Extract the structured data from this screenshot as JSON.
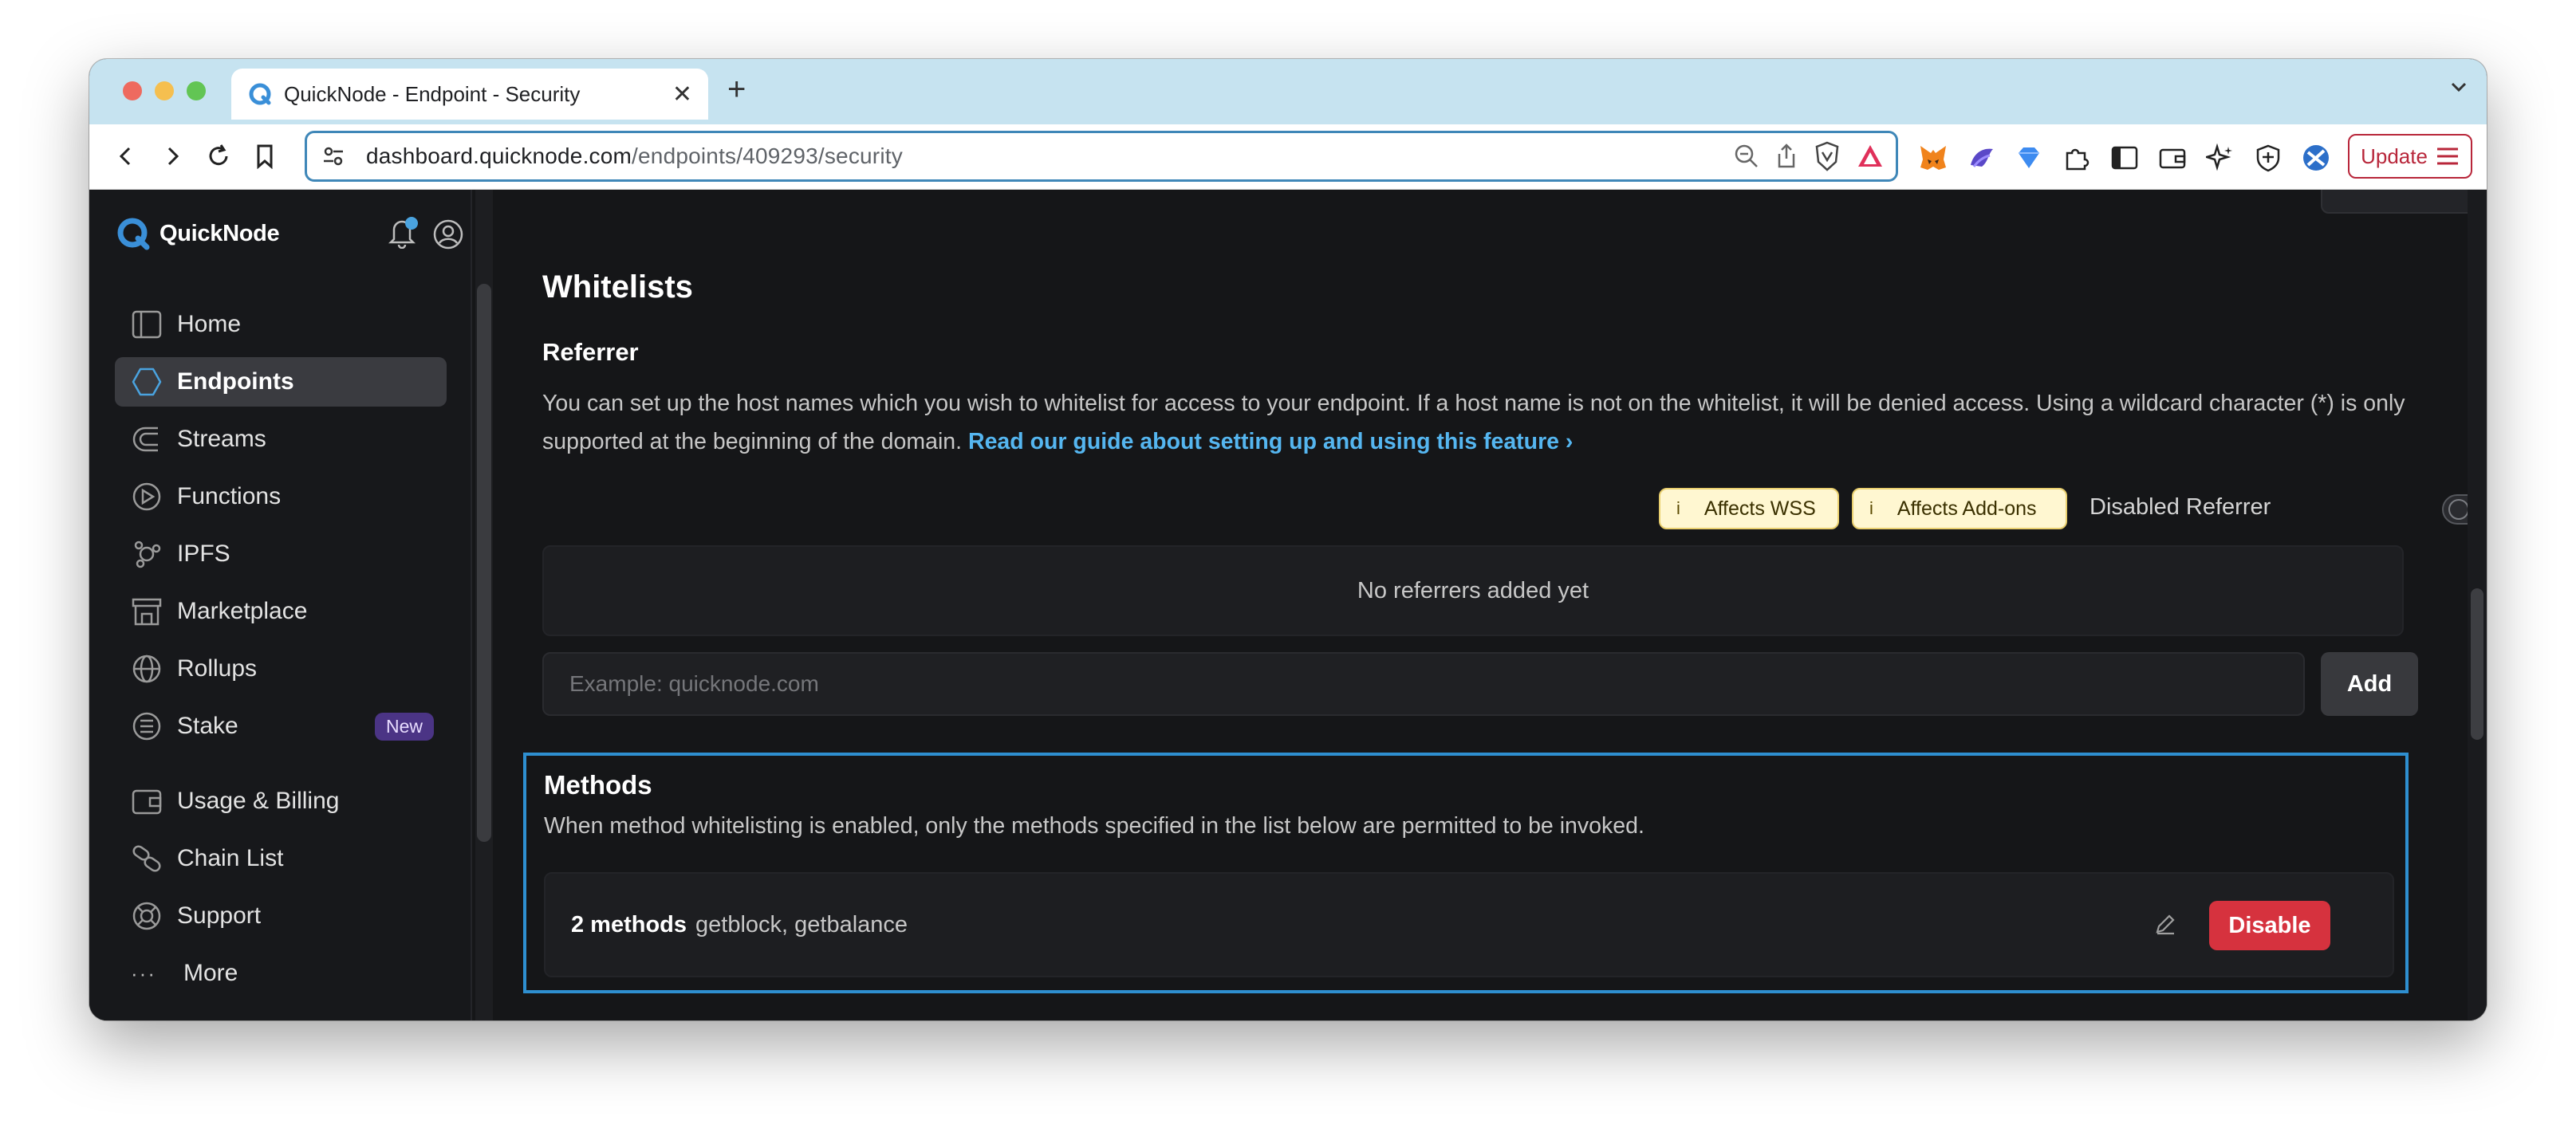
{
  "browser": {
    "tab_title": "QuickNode - Endpoint - Security",
    "url_host": "dashboard.quicknode.com",
    "url_path": "/endpoints/409293/security",
    "update_label": "Update"
  },
  "sidebar": {
    "logo_text": "QuickNode",
    "items": [
      {
        "label": "Home",
        "icon": "home-icon"
      },
      {
        "label": "Endpoints",
        "icon": "endpoints-icon",
        "active": true
      },
      {
        "label": "Streams",
        "icon": "streams-icon"
      },
      {
        "label": "Functions",
        "icon": "functions-icon"
      },
      {
        "label": "IPFS",
        "icon": "ipfs-icon"
      },
      {
        "label": "Marketplace",
        "icon": "marketplace-icon"
      },
      {
        "label": "Rollups",
        "icon": "rollups-icon"
      },
      {
        "label": "Stake",
        "icon": "stake-icon",
        "badge": "New"
      }
    ],
    "secondary": [
      {
        "label": "Usage & Billing",
        "icon": "billing-icon"
      },
      {
        "label": "Chain List",
        "icon": "chain-list-icon"
      },
      {
        "label": "Support",
        "icon": "support-icon"
      }
    ],
    "more_label": "More"
  },
  "whitelists": {
    "title": "Whitelists",
    "referrer": {
      "title": "Referrer",
      "description": "You can set up the host names which you wish to whitelist for access to your endpoint. If a host name is not on the whitelist, it will be denied access. Using a wildcard character (*) is only supported at the beginning of the domain.",
      "guide_link": "Read our guide about setting up and using this feature",
      "pill_wss": "Affects WSS",
      "pill_addons": "Affects Add-ons",
      "toggle_label": "Disabled Referrer",
      "toggle_enabled": false,
      "empty_text": "No referrers added yet",
      "input_placeholder": "Example: quicknode.com",
      "input_value": "",
      "add_label": "Add"
    },
    "methods": {
      "title": "Methods",
      "description": "When method whitelisting is enabled, only the methods specified in the list below are permitted to be invoked.",
      "count_label": "2 methods",
      "list": "getblock, getbalance",
      "disable_label": "Disable"
    }
  },
  "colors": {
    "accent": "#2e8fd0",
    "link": "#55b6f0",
    "danger": "#d6323e",
    "badge_new": "#4b3485"
  }
}
